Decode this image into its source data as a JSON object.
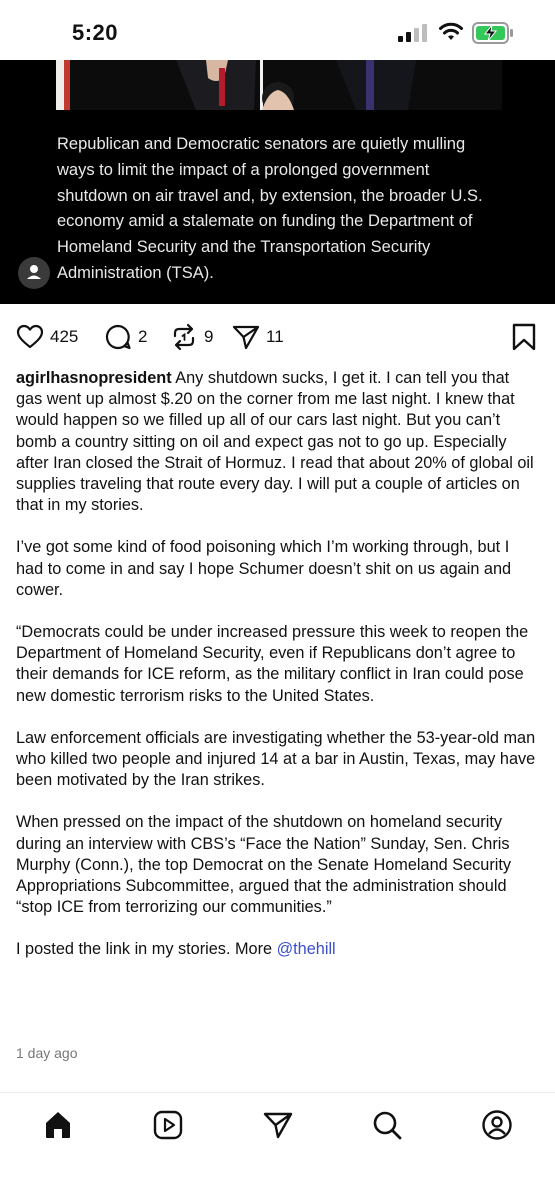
{
  "status_bar": {
    "time": "5:20"
  },
  "media": {
    "caption": "Republican and Democratic senators are quietly mulling ways to limit the impact of a prolonged government shutdown on air travel and, by extension, the broader U.S. economy amid a stalemate on funding the Department of Homeland Security and the Transportation Security Administration (TSA).",
    "tag_icon": "person-icon"
  },
  "actions": {
    "likes": "425",
    "comments": "2",
    "reposts": "9",
    "shares": "11"
  },
  "post": {
    "username": "agirlhasnopresident",
    "first_paragraph": "Any shutdown sucks, I get it. I can tell you that gas went up almost $.20 on the corner from me last night. I knew that would happen so we filled up all of our cars last night. But you can’t bomb a country sitting on oil and expect gas not to go up. Especially after Iran closed the Strait of Hormuz. I read that about 20% of global oil supplies traveling that route every day. I will put a couple of articles on that in my stories.",
    "paragraphs": [
      "I’ve got some kind of food poisoning which I’m working through, but I had to come in and say I hope Schumer doesn’t shit on us again and cower.",
      "“Democrats could be under increased pressure this week to reopen the Department of Homeland Security, even if Republicans don’t agree to their demands for ICE reform, as the military conflict in Iran could pose new domestic terrorism risks to the United States.",
      "Law enforcement officials are investigating whether the 53-year-old man who killed two people and injured 14 at a bar in Austin, Texas, may have been motivated by the Iran strikes.",
      "When pressed on the impact of the shutdown on homeland security during an interview with CBS’s “Face the Nation” Sunday, Sen. Chris Murphy (Conn.), the top Democrat on the Senate Homeland Security Appropriations Subcommittee, argued that the administration should “stop ICE from terrorizing our communities.”"
    ],
    "last_line_text": "I posted the link in my stories. More ",
    "mention": "@thehill",
    "timestamp": "1 day ago"
  },
  "bottom_nav": {
    "items": [
      "home",
      "reels",
      "messages",
      "search",
      "profile"
    ]
  }
}
